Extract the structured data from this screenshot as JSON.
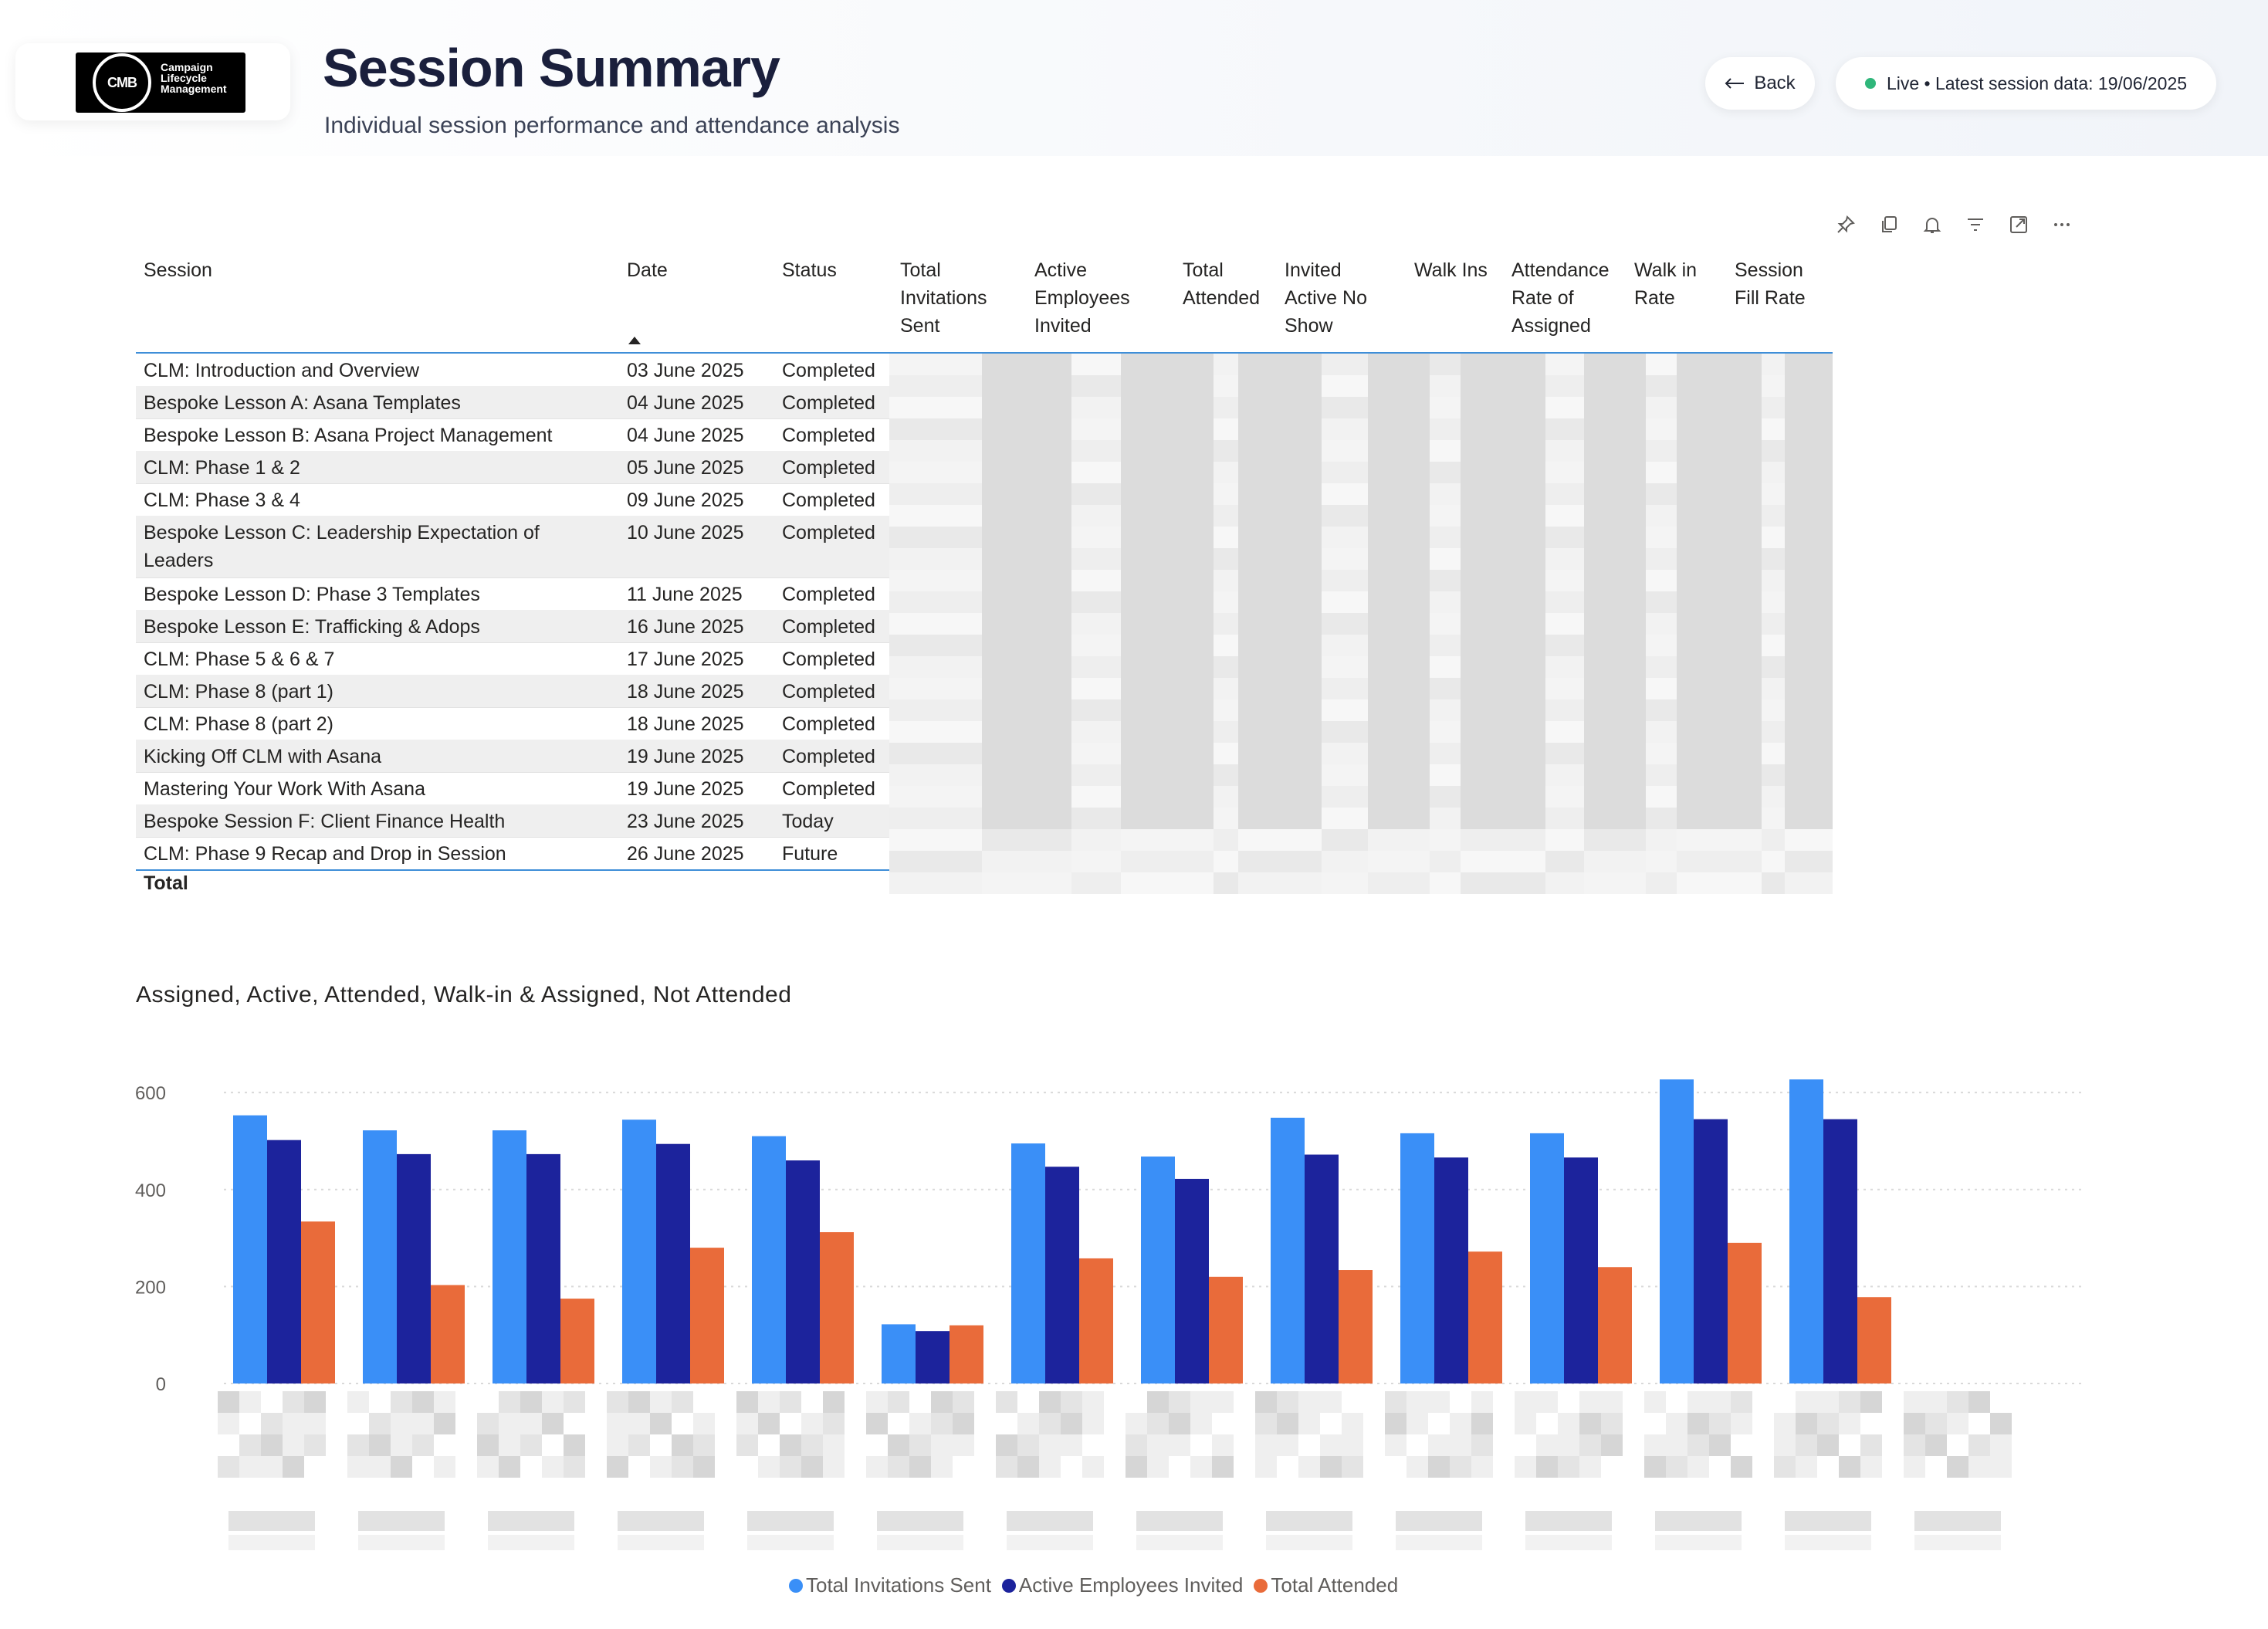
{
  "header": {
    "logo_badge": "CMB",
    "logo_text": "Campaign\nLifecycle\nManagement",
    "title": "Session Summary",
    "subtitle": "Individual session performance and attendance analysis",
    "back_label": "Back",
    "back_icon": "arrow-left-icon",
    "live_text": "Live • Latest session data: 19/06/2025",
    "live_color": "#2fb67a"
  },
  "visual_header_icons": [
    "pin-icon",
    "copy-icon",
    "bell-icon",
    "filter-icon",
    "focus-mode-icon",
    "more-options-icon"
  ],
  "table": {
    "columns": [
      "Session",
      "Date",
      "Status",
      "Total\nInvitations\nSent",
      "Active\nEmployees\nInvited",
      "Total\nAttended",
      "Invited\nActive No\nShow",
      "Walk Ins",
      "Attendance\nRate of\nAssigned",
      "Walk in\nRate",
      "Session\nFill Rate"
    ],
    "sorted_column": "Date",
    "rows": [
      {
        "session": "CLM: Introduction and Overview",
        "date": "03 June 2025",
        "status": "Completed"
      },
      {
        "session": "Bespoke Lesson A: Asana Templates",
        "date": "04 June 2025",
        "status": "Completed"
      },
      {
        "session": "Bespoke Lesson B: Asana Project Management",
        "date": "04 June 2025",
        "status": "Completed"
      },
      {
        "session": "CLM: Phase 1 & 2",
        "date": "05 June 2025",
        "status": "Completed"
      },
      {
        "session": "CLM: Phase 3 & 4",
        "date": "09 June 2025",
        "status": "Completed"
      },
      {
        "session": "Bespoke Lesson C: Leadership Expectation of Leaders",
        "date": "10 June 2025",
        "status": "Completed"
      },
      {
        "session": "Bespoke Lesson D: Phase 3 Templates",
        "date": "11 June 2025",
        "status": "Completed"
      },
      {
        "session": "Bespoke Lesson E: Trafficking & Adops",
        "date": "16 June 2025",
        "status": "Completed"
      },
      {
        "session": "CLM: Phase 5 & 6 & 7",
        "date": "17 June 2025",
        "status": "Completed"
      },
      {
        "session": "CLM: Phase 8 (part 1)",
        "date": "18 June 2025",
        "status": "Completed"
      },
      {
        "session": "CLM: Phase 8 (part 2)",
        "date": "18 June 2025",
        "status": "Completed"
      },
      {
        "session": "Kicking Off CLM with Asana",
        "date": "19 June 2025",
        "status": "Completed"
      },
      {
        "session": "Mastering Your Work With Asana",
        "date": "19 June 2025",
        "status": "Completed"
      },
      {
        "session": "Bespoke Session F: Client Finance Health",
        "date": "23 June 2025",
        "status": "Today"
      },
      {
        "session": "CLM: Phase 9 Recap and Drop in Session",
        "date": "26 June 2025",
        "status": "Future"
      }
    ],
    "total_label": "Total"
  },
  "chart_data": {
    "type": "bar",
    "title": "Assigned, Active, Attended, Walk-in & Assigned, Not Attended",
    "categories": [
      "",
      "",
      "",
      "",
      "",
      "",
      "",
      "",
      "",
      "",
      "",
      "",
      "",
      ""
    ],
    "series": [
      {
        "name": "Total Invitations Sent",
        "color": "#3a8ff7",
        "values": [
          553,
          522,
          522,
          544,
          510,
          122,
          495,
          468,
          548,
          516,
          516,
          627,
          627,
          0
        ]
      },
      {
        "name": "Active Employees Invited",
        "color": "#1c239c",
        "values": [
          502,
          473,
          473,
          494,
          460,
          108,
          447,
          422,
          472,
          466,
          466,
          545,
          545,
          0
        ]
      },
      {
        "name": "Total Attended",
        "color": "#e96b3a",
        "values": [
          334,
          203,
          175,
          280,
          312,
          120,
          258,
          220,
          234,
          272,
          240,
          290,
          178,
          0
        ]
      }
    ],
    "yticks": [
      0,
      200,
      400,
      600
    ],
    "ylim": [
      0,
      640
    ],
    "xlabel": "",
    "ylabel": "",
    "grid": true,
    "legend_position": "bottom-center"
  }
}
